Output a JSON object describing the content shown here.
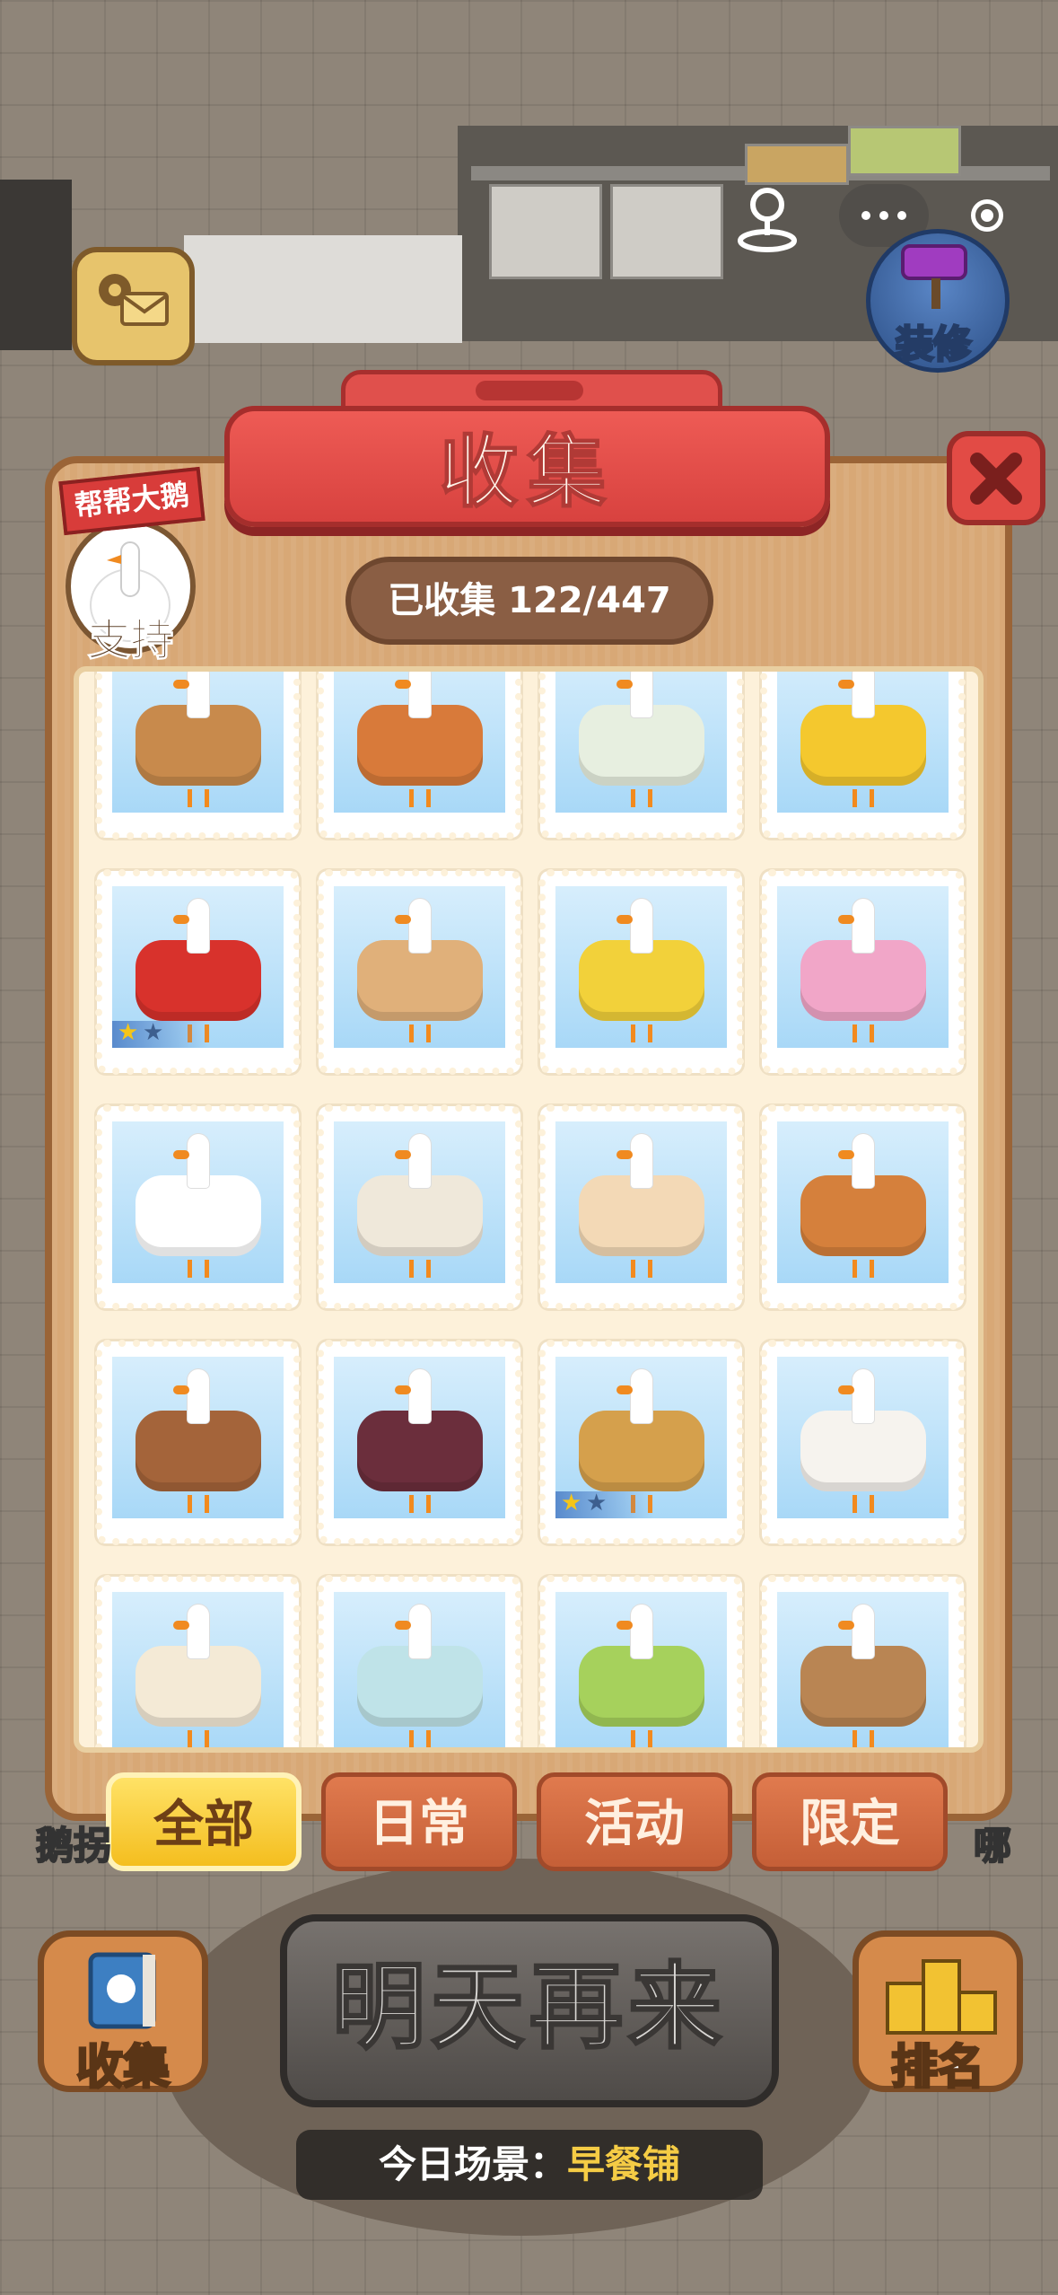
{
  "hud": {
    "decorate_label": "装修",
    "collect_label": "收集",
    "rank_label": "排名",
    "come_back_label": "明天再来",
    "scene_label": "今日场景：",
    "scene_value": "早餐铺",
    "left_cutoff_label": "鹅拐",
    "right_cutoff_label": "哪"
  },
  "support_badge": {
    "banner": "帮帮大鹅",
    "label": "支持"
  },
  "panel": {
    "title": "收集",
    "counter": "已收集 122/447"
  },
  "tabs": [
    {
      "label": "全部",
      "active": true
    },
    {
      "label": "日常",
      "active": false
    },
    {
      "label": "活动",
      "active": false
    },
    {
      "label": "限定",
      "active": false
    }
  ],
  "items": [
    {
      "name": "mooncake-goose",
      "color": "#c88a4c",
      "stars": 0
    },
    {
      "name": "hotpot-goose",
      "color": "#d87a3a",
      "stars": 0
    },
    {
      "name": "paint-bucket-goose",
      "color": "#e7efe0",
      "stars": 0
    },
    {
      "name": "sunflower-goose",
      "color": "#f4c82e",
      "stars": 0
    },
    {
      "name": "instant-noodle-goose",
      "color": "#d8322c",
      "stars": 1
    },
    {
      "name": "bread-toast-goose",
      "color": "#e0b07a",
      "stars": 0
    },
    {
      "name": "mustard-bottle-goose",
      "color": "#f2d13a",
      "stars": 0
    },
    {
      "name": "rose-goose",
      "color": "#f1a6c8",
      "stars": 0
    },
    {
      "name": "neon-goose",
      "color": "#ffffff",
      "stars": 0
    },
    {
      "name": "suitcase-goose",
      "color": "#efe8da",
      "stars": 0
    },
    {
      "name": "cow-goose",
      "color": "#f3d9b6",
      "stars": 0
    },
    {
      "name": "pie-goose",
      "color": "#d5803c",
      "stars": 0
    },
    {
      "name": "log-goose",
      "color": "#a4643a",
      "stars": 0
    },
    {
      "name": "passion-fruit-goose",
      "color": "#6b2e3c",
      "stars": 0
    },
    {
      "name": "trumpet-goose",
      "color": "#d5a04c",
      "stars": 1
    },
    {
      "name": "award-mug-goose",
      "color": "#f6f3ee",
      "stars": 0
    },
    {
      "name": "garlic-goose",
      "color": "#f4ead6",
      "stars": 0
    },
    {
      "name": "display-case-goose",
      "color": "#bfe3e8",
      "stars": 0
    },
    {
      "name": "gardener-goose",
      "color": "#a6d15c",
      "stars": 0
    },
    {
      "name": "clay-pot-goose",
      "color": "#b98553",
      "stars": 0
    }
  ],
  "colors": {
    "title_red": "#e0504c",
    "active_tab": "#f4be1f",
    "inactive_tab": "#c55f37",
    "panel_wood": "#d8a876",
    "scene_highlight": "#f5cc45"
  }
}
